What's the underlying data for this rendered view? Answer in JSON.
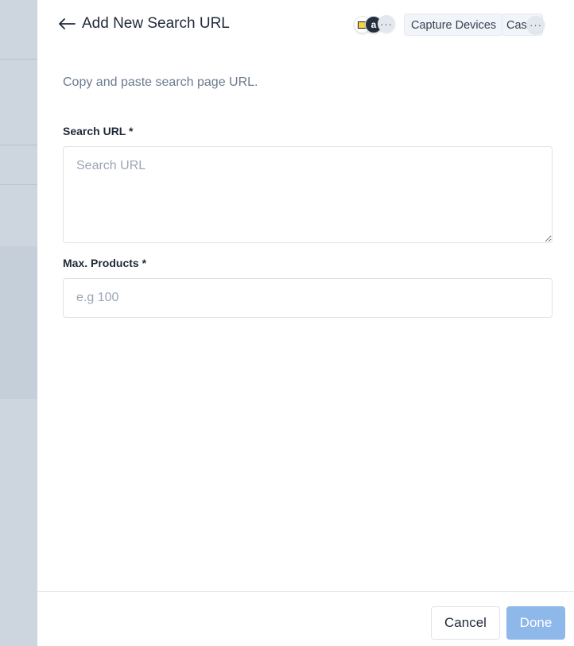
{
  "header": {
    "title": "Add New Search URL",
    "back_icon": "arrow-left-icon",
    "stores": {
      "bestbuy_icon": "bestbuy-logo-icon",
      "amazon_icon": "amazon-logo-icon",
      "amazon_glyph": "a",
      "more_label": "···"
    },
    "categories": {
      "chip_1": "Capture Devices",
      "chip_2": "Case",
      "more_label": "···"
    }
  },
  "form": {
    "subtitle": "Copy and paste search page URL.",
    "search_url": {
      "label": "Search URL *",
      "placeholder": "Search URL",
      "value": ""
    },
    "max_products": {
      "label": "Max. Products *",
      "placeholder": "e.g 100",
      "value": ""
    }
  },
  "footer": {
    "cancel_label": "Cancel",
    "done_label": "Done"
  },
  "colors": {
    "primary_disabled": "#8fb8ea",
    "backdrop": "#cdd6df",
    "subtitle": "#6b7b90"
  }
}
